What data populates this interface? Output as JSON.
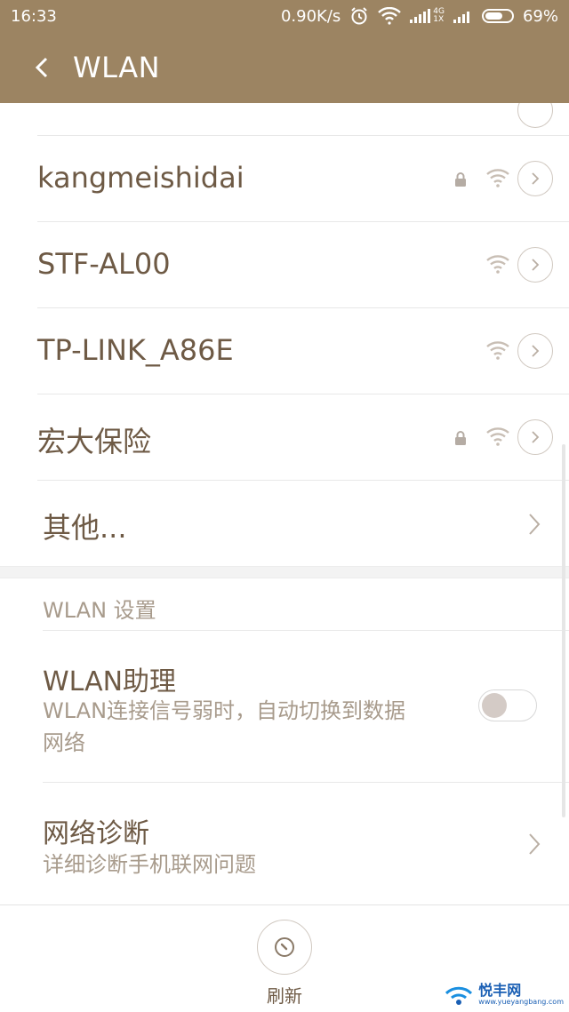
{
  "status_bar": {
    "time": "16:33",
    "speed": "0.90K/s",
    "network_4g": "4G",
    "network_1x": "1X",
    "battery_percent": "69%",
    "battery_level": 0.69
  },
  "app_bar": {
    "title": "WLAN"
  },
  "networks": [
    {
      "name": "kangmeishidai",
      "locked": true
    },
    {
      "name": "STF-AL00",
      "locked": false
    },
    {
      "name": "TP-LINK_A86E",
      "locked": false
    },
    {
      "name": "宏大保险",
      "locked": true
    }
  ],
  "other_label": "其他...",
  "settings_section": {
    "header": "WLAN 设置",
    "assistant": {
      "title": "WLAN助理",
      "desc_line1": "WLAN连接信号弱时，自动切换到数据",
      "desc_line2": "网络",
      "enabled": false
    },
    "diagnose": {
      "title": "网络诊断",
      "desc": "详细诊断手机联网问题"
    }
  },
  "bottom": {
    "refresh_label": "刷新"
  },
  "watermark": {
    "name": "悦丰网",
    "url": "www.yueyangbang.com"
  },
  "colors": {
    "accent": "#9c8462",
    "text": "#6e5a45",
    "muted": "#a89b8c"
  }
}
